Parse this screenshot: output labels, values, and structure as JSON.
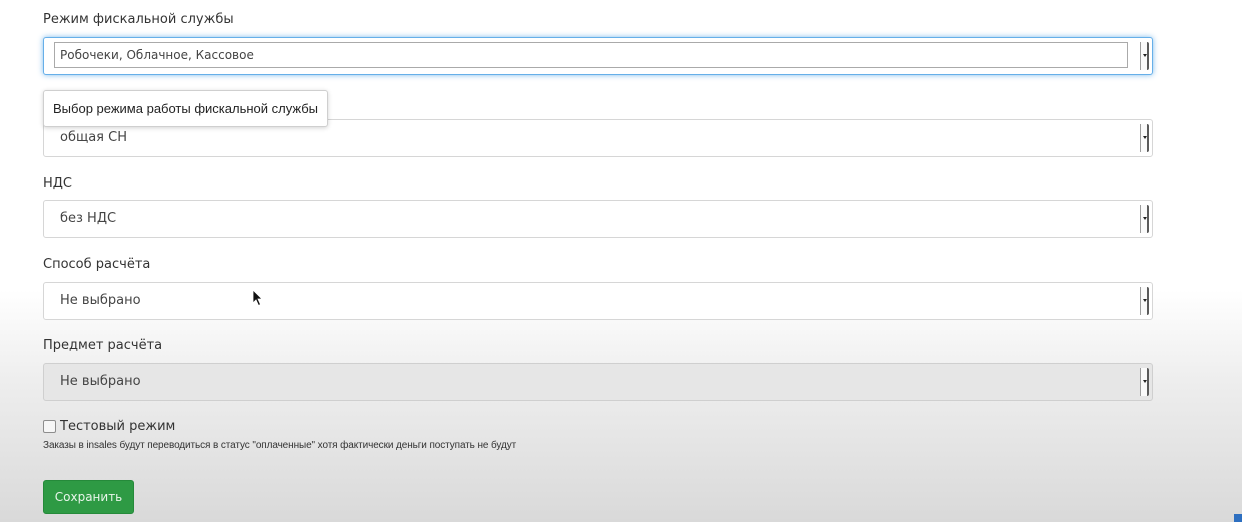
{
  "fields": {
    "fiscal_mode": {
      "label": "Режим фискальной службы",
      "value": "Робочеки, Облачное, Кассовое",
      "tooltip": "Выбор режима работы фискальной службы"
    },
    "tax_system": {
      "value": "общая СН"
    },
    "vat": {
      "label": "НДС",
      "value": "без НДС"
    },
    "payment_method": {
      "label": "Способ расчёта",
      "value": "Не выбрано"
    },
    "payment_subject": {
      "label": "Предмет расчёта",
      "value": "Не выбрано"
    }
  },
  "test_mode": {
    "label": "Тестовый режим",
    "checked": false,
    "hint": "Заказы в insales будут переводиться в статус \"оплаченные\" хотя фактически деньги поступать не будут"
  },
  "save_button": {
    "label": "Сохранить"
  },
  "colors": {
    "accent_green": "#2e9a44",
    "focus_blue": "#66afe9"
  },
  "icons": {
    "cursor": "mouse-pointer-icon",
    "dropdown": "chevron-down-icon"
  }
}
